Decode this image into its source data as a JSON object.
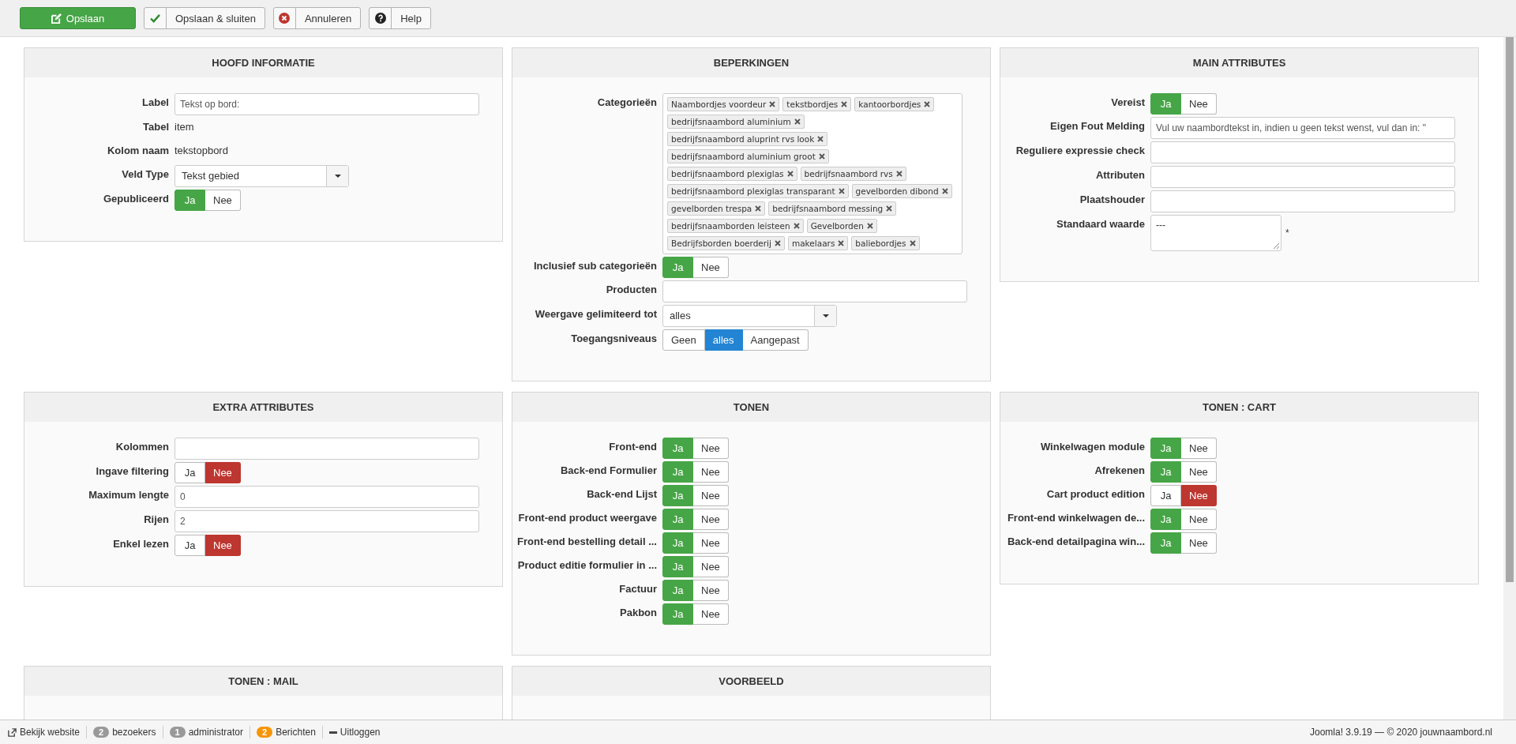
{
  "toolbar": [
    {
      "label": "Opslaan",
      "kind": "primary"
    },
    {
      "label": "Opslaan & sluiten",
      "kind": "default"
    },
    {
      "label": "Annuleren",
      "kind": "default"
    },
    {
      "label": "Help",
      "kind": "default"
    }
  ],
  "panels": [
    {
      "title": "HOOFD INFORMATIE",
      "rows": [
        {
          "kind": "input",
          "label": "Label",
          "value": "Tekst op bord:"
        },
        {
          "kind": "text",
          "label": "Tabel",
          "value": "item"
        },
        {
          "kind": "text",
          "label": "Kolom naam",
          "value": "tekstopbord"
        },
        {
          "kind": "select",
          "label": "Veld Type",
          "value": "Tekst gebied"
        },
        {
          "kind": "toggle",
          "label": "Gepubliceerd",
          "options": [
            {
              "label": "Ja",
              "selected": true
            },
            {
              "label": "Nee",
              "selected": false
            }
          ]
        }
      ]
    },
    {
      "title": "BEPERKINGEN",
      "rows": [
        {
          "kind": "tags",
          "label": "Categorieën",
          "tags": [
            "Naambordjes voordeur",
            "tekstbordjes",
            "kantoorbordjes",
            "bedrijfsnaambord aluminium",
            "bedrijfsnaambord aluprint rvs look",
            "bedrijfsnaambord aluminium groot",
            "bedrijfsnaambord plexiglas",
            "bedrijfsnaambord rvs",
            "bedrijfsnaambord plexiglas transparant",
            "gevelborden dibond",
            "gevelborden trespa",
            "bedrijfsnaambord messing",
            "bedrijfsnaamborden leisteen",
            "Gevelborden",
            "Bedrijfsborden boerderij",
            "makelaars",
            "baliebordjes"
          ]
        },
        {
          "kind": "toggle",
          "label": "Inclusief sub categorieën",
          "options": [
            {
              "label": "Ja",
              "selected": true
            },
            {
              "label": "Nee",
              "selected": false
            }
          ]
        },
        {
          "kind": "input",
          "label": "Producten"
        },
        {
          "kind": "select",
          "label": "Weergave gelimiteerd tot",
          "value": "alles"
        },
        {
          "kind": "choice",
          "label": "Toegangsniveaus",
          "options": [
            {
              "label": "Geen",
              "selected": false
            },
            {
              "label": "alles",
              "selected": true
            },
            {
              "label": "Aangepast",
              "selected": false
            }
          ]
        }
      ]
    },
    {
      "title": "MAIN ATTRIBUTES",
      "rows": [
        {
          "kind": "toggle",
          "label": "Vereist",
          "options": [
            {
              "label": "Ja",
              "selected": true
            },
            {
              "label": "Nee",
              "selected": false
            }
          ]
        },
        {
          "kind": "input",
          "label": "Eigen Fout Melding",
          "value": "Vul uw naambordtekst in, indien u geen tekst wenst, vul dan in: \""
        },
        {
          "kind": "input",
          "label": "Reguliere expressie check"
        },
        {
          "kind": "input",
          "label": "Attributen"
        },
        {
          "kind": "input",
          "label": "Plaatshouder"
        },
        {
          "kind": "textarea",
          "label": "Standaard waarde",
          "value": "---",
          "note": "*"
        }
      ]
    },
    {
      "title": "EXTRA ATTRIBUTES",
      "rows": [
        {
          "kind": "input",
          "label": "Kolommen"
        },
        {
          "kind": "toggle",
          "label": "Ingave filtering",
          "options": [
            {
              "label": "Ja",
              "selected": false
            },
            {
              "label": "Nee",
              "selected": true
            }
          ]
        },
        {
          "kind": "input",
          "label": "Maximum lengte",
          "value": "0"
        },
        {
          "kind": "input",
          "label": "Rijen",
          "value": "2"
        },
        {
          "kind": "toggle",
          "label": "Enkel lezen",
          "options": [
            {
              "label": "Ja",
              "selected": false
            },
            {
              "label": "Nee",
              "selected": true
            }
          ]
        }
      ]
    },
    {
      "title": "TONEN",
      "rows": [
        {
          "kind": "toggle",
          "label": "Front-end",
          "options": [
            {
              "label": "Ja",
              "selected": true
            },
            {
              "label": "Nee",
              "selected": false
            }
          ]
        },
        {
          "kind": "toggle",
          "label": "Back-end Formulier",
          "options": [
            {
              "label": "Ja",
              "selected": true
            },
            {
              "label": "Nee",
              "selected": false
            }
          ]
        },
        {
          "kind": "toggle",
          "label": "Back-end Lijst",
          "options": [
            {
              "label": "Ja",
              "selected": true
            },
            {
              "label": "Nee",
              "selected": false
            }
          ]
        },
        {
          "kind": "toggle",
          "label": "Front-end product weergave",
          "options": [
            {
              "label": "Ja",
              "selected": true
            },
            {
              "label": "Nee",
              "selected": false
            }
          ]
        },
        {
          "kind": "toggle",
          "label": "Front-end bestelling detail ...",
          "options": [
            {
              "label": "Ja",
              "selected": true
            },
            {
              "label": "Nee",
              "selected": false
            }
          ]
        },
        {
          "kind": "toggle",
          "label": "Product editie formulier in ...",
          "options": [
            {
              "label": "Ja",
              "selected": true
            },
            {
              "label": "Nee",
              "selected": false
            }
          ]
        },
        {
          "kind": "toggle",
          "label": "Factuur",
          "options": [
            {
              "label": "Ja",
              "selected": true
            },
            {
              "label": "Nee",
              "selected": false
            }
          ]
        },
        {
          "kind": "toggle",
          "label": "Pakbon",
          "options": [
            {
              "label": "Ja",
              "selected": true
            },
            {
              "label": "Nee",
              "selected": false
            }
          ]
        }
      ]
    },
    {
      "title": "TONEN : CART",
      "rows": [
        {
          "kind": "toggle",
          "label": "Winkelwagen module",
          "options": [
            {
              "label": "Ja",
              "selected": true
            },
            {
              "label": "Nee",
              "selected": false
            }
          ]
        },
        {
          "kind": "toggle",
          "label": "Afrekenen",
          "options": [
            {
              "label": "Ja",
              "selected": true
            },
            {
              "label": "Nee",
              "selected": false
            }
          ]
        },
        {
          "kind": "toggle",
          "label": "Cart product edition",
          "options": [
            {
              "label": "Ja",
              "selected": false
            },
            {
              "label": "Nee",
              "selected": true
            }
          ]
        },
        {
          "kind": "toggle",
          "label": "Front-end winkelwagen de...",
          "options": [
            {
              "label": "Ja",
              "selected": true
            },
            {
              "label": "Nee",
              "selected": false
            }
          ]
        },
        {
          "kind": "toggle",
          "label": "Back-end detailpagina win...",
          "options": [
            {
              "label": "Ja",
              "selected": true
            },
            {
              "label": "Nee",
              "selected": false
            }
          ]
        }
      ]
    },
    {
      "title": "TONEN : MAIL"
    },
    {
      "title": "VOORBEELD"
    }
  ],
  "status_bar": {
    "left": [
      {
        "kind": "link",
        "label": "Bekijk website"
      },
      {
        "kind": "badge",
        "count": "2",
        "label": "bezoekers",
        "color": "#999999"
      },
      {
        "kind": "badge",
        "count": "1",
        "label": "administrator",
        "color": "#999999"
      },
      {
        "kind": "badge",
        "count": "2",
        "label": "Berichten",
        "color": "#f89406"
      },
      {
        "kind": "logout",
        "label": "Uitloggen"
      }
    ],
    "right": "Joomla! 3.9.19 — © 2020 jouwnaambord.nl"
  }
}
